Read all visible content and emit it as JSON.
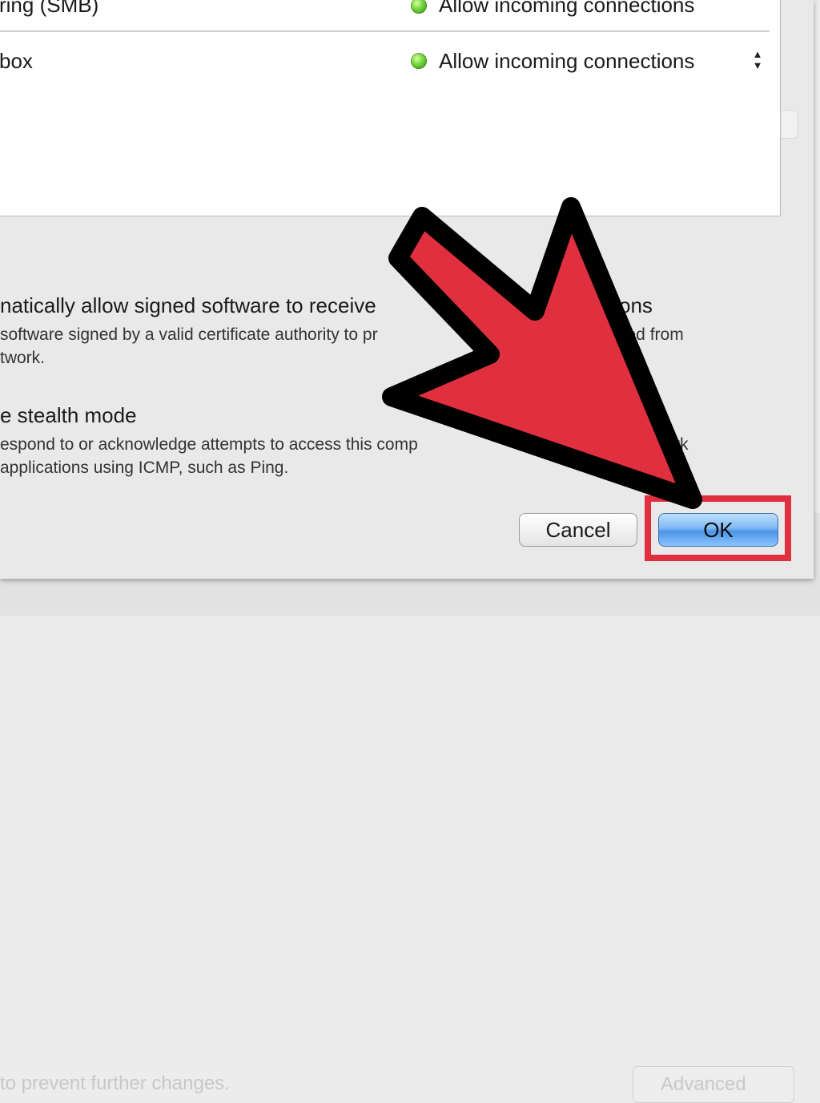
{
  "services": [
    {
      "name": "ring (SMB)",
      "status": "Allow incoming connections",
      "status_color": "#5cc828"
    },
    {
      "name": "box",
      "status": "Allow incoming connections",
      "status_color": "#5cc828"
    }
  ],
  "icons": {
    "status": "green-dot-icon",
    "stepper": "up-down-stepper-icon",
    "annotation": "red-arrow-icon"
  },
  "options": {
    "signed_title": "natically allow signed software to receive",
    "signed_title_tail": "ons",
    "signed_desc_line1": "software signed by a valid certificate authority to pr",
    "signed_desc_line1_tail": "sed from",
    "signed_desc_line2": "twork.",
    "stealth_title": "e stealth mode",
    "stealth_desc_line1": "espond to or acknowledge attempts to access this comp",
    "stealth_desc_line1_tail": "rk",
    "stealth_desc_line2": "applications using ICMP, such as Ping."
  },
  "buttons": {
    "cancel": "Cancel",
    "ok": "OK"
  },
  "background_window": {
    "lock_text": "to prevent further changes.",
    "advanced": "Advanced"
  },
  "colors": {
    "highlight": "#e0303f",
    "arrow_fill": "#e0303f",
    "arrow_stroke": "#000000"
  }
}
